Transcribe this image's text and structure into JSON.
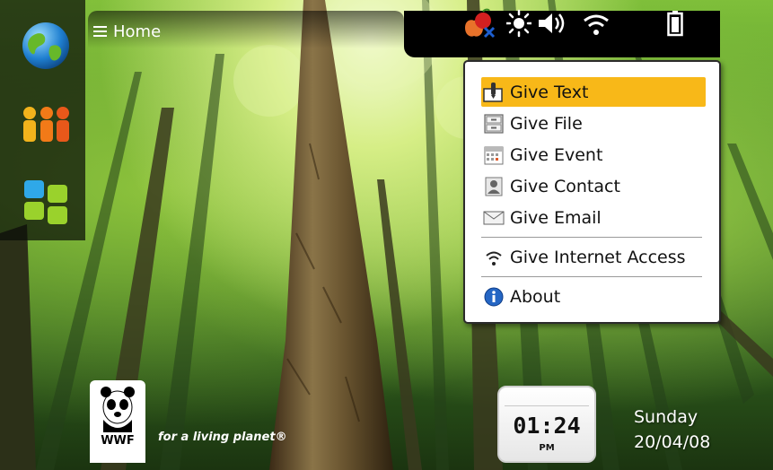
{
  "header": {
    "title": "Home",
    "menu_icon": "menu-icon"
  },
  "launcher": {
    "items": [
      {
        "icon": "globe-icon"
      },
      {
        "icon": "contacts-icon"
      },
      {
        "icon": "applications-icon"
      }
    ]
  },
  "status_bar": {
    "icons": [
      "fruit-app-icon",
      "brightness-icon",
      "volume-icon",
      "wifi-icon",
      "battery-icon"
    ]
  },
  "popup_menu": {
    "items": [
      {
        "label": "Give Text",
        "icon": "text-pen-icon",
        "selected": true
      },
      {
        "label": "Give File",
        "icon": "file-cabinet-icon",
        "selected": false
      },
      {
        "label": "Give Event",
        "icon": "calendar-icon",
        "selected": false
      },
      {
        "label": "Give Contact",
        "icon": "contact-card-icon",
        "selected": false
      },
      {
        "label": "Give Email",
        "icon": "envelope-icon",
        "selected": false
      },
      {
        "label": "Give Internet Access",
        "icon": "wifi-icon",
        "selected": false
      },
      {
        "label": "About",
        "icon": "info-icon",
        "selected": false
      }
    ],
    "highlight_color": "#f8b818"
  },
  "wwf": {
    "logo_text": "WWF",
    "tagline": "for a living planet®"
  },
  "clock": {
    "time": "01:24",
    "period": "PM"
  },
  "date": {
    "day": "Sunday",
    "value": "20/04/08"
  }
}
